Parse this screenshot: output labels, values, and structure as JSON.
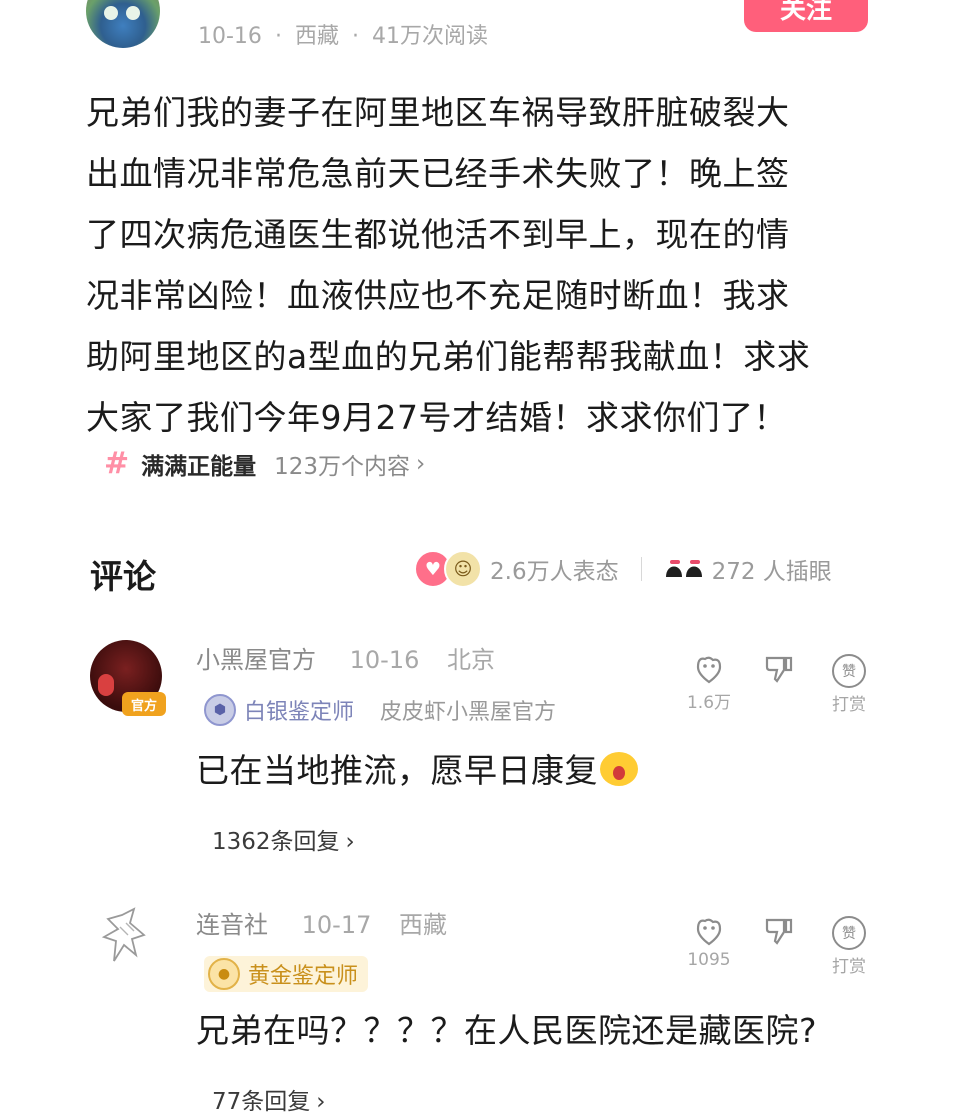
{
  "post": {
    "meta": {
      "date": "10-16",
      "location": "西藏",
      "reads": "41万次阅读",
      "separator": "·"
    },
    "follow_label": "关注",
    "lines": [
      "兄弟们我的妻子在阿里地区车祸导致肝脏破裂大",
      "出血情况非常危急前天已经手术失败了！晚上签",
      "了四次病危通医生都说他活不到早上，现在的情",
      "况非常凶险！血液供应也不充足随时断血！我求",
      "助阿里地区的a型血的兄弟们能帮帮我献血！求求",
      "大家了我们今年9月27号才结婚！求求你们了！"
    ],
    "topic": {
      "hash": "#",
      "name": "满满正能量",
      "count": "123万个内容",
      "chevron": "›"
    }
  },
  "comments_section": {
    "title": "评论",
    "reactions_count": "2.6万人表态",
    "eyes_count": "272 人插眼"
  },
  "comments": [
    {
      "name": "小黑屋官方",
      "date": "10-16",
      "location": "北京",
      "badge": "官方",
      "cert": "白银鉴定师",
      "tagline": "皮皮虾小黑屋官方",
      "text": "已在当地推流，愿早日康复",
      "likes": "1.6万",
      "reward_label": "打赏",
      "replies": "1362条回复",
      "chevron": "›"
    },
    {
      "name": "连音社",
      "date": "10-17",
      "location": "西藏",
      "cert": "黄金鉴定师",
      "text": "兄弟在吗？？？？在人民医院还是藏医院?",
      "likes": "1095",
      "reward_label": "打赏",
      "replies": "77条回复",
      "chevron": "›"
    }
  ],
  "icons": {
    "hash": "hash-icon",
    "like": "like-reaction-icon",
    "face": "face-reaction-icon",
    "eyes": "eyes-icon",
    "thumbs_up": "thumbs-up-icon",
    "thumbs_down": "thumbs-down-icon",
    "reward": "reward-icon",
    "cert": "cert-icon"
  },
  "colors": {
    "accent": "#ff5f7b",
    "topic_hash": "#ff8fa6",
    "silver_cert": "#7d84b8",
    "gold_cert": "#c9901c",
    "official_badge": "#f0a21e"
  }
}
